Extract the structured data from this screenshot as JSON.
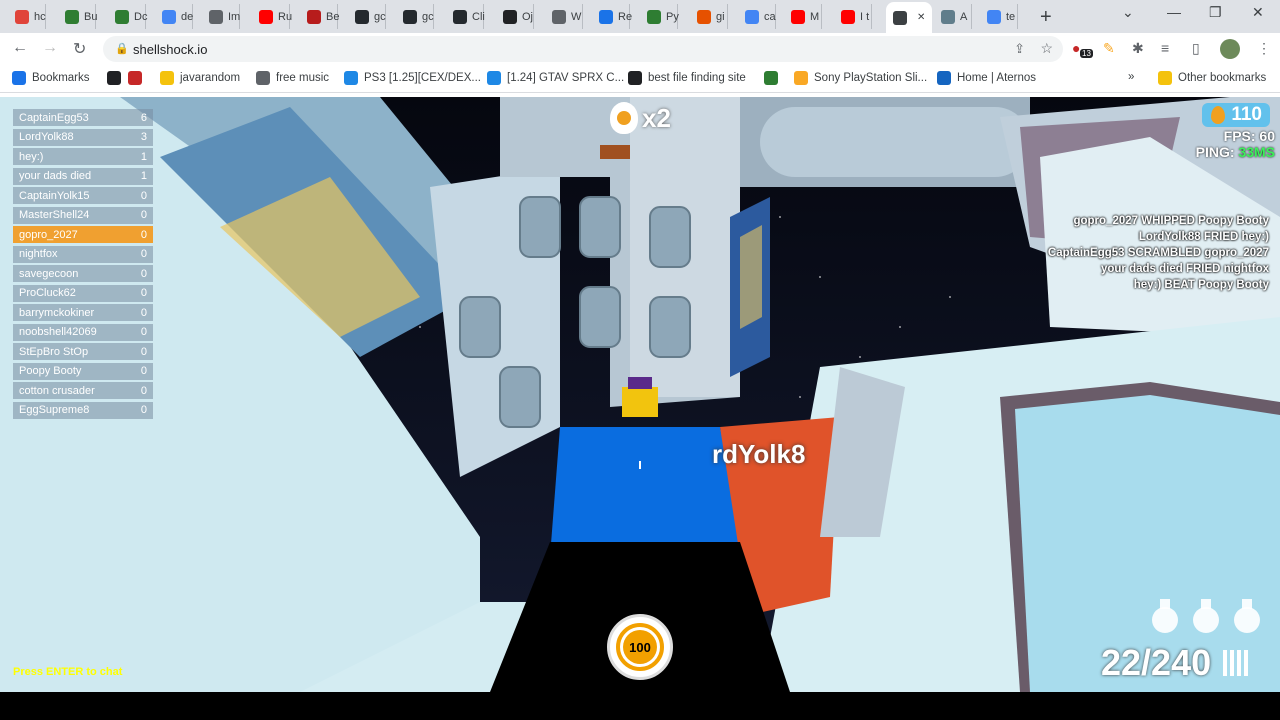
{
  "browser": {
    "tabs": [
      {
        "label": "hc",
        "color": "#e0443a"
      },
      {
        "label": "Bu",
        "color": "#2f7d32"
      },
      {
        "label": "Dc",
        "color": "#2f7d32"
      },
      {
        "label": "de",
        "color": "#4285f4"
      },
      {
        "label": "Im",
        "color": "#5f6368"
      },
      {
        "label": "Ru",
        "color": "#ff0000"
      },
      {
        "label": "Be",
        "color": "#b71c1c"
      },
      {
        "label": "gc",
        "color": "#24292e"
      },
      {
        "label": "gc",
        "color": "#24292e"
      },
      {
        "label": "Cli",
        "color": "#24292e"
      },
      {
        "label": "Oj",
        "color": "#202124"
      },
      {
        "label": "W",
        "color": "#5f6368"
      },
      {
        "label": "Re",
        "color": "#1a73e8"
      },
      {
        "label": "Py",
        "color": "#2e7d32"
      },
      {
        "label": "gi",
        "color": "#e65100"
      },
      {
        "label": "ca",
        "color": "#4285f4"
      },
      {
        "label": "M",
        "color": "#ff0000"
      },
      {
        "label": "I t",
        "color": "#ff0000"
      },
      {
        "label": "",
        "color": "#3c4043"
      },
      {
        "label": "A",
        "color": "#607d8b"
      },
      {
        "label": "te",
        "color": "#4285f4"
      }
    ],
    "new_tab": "+",
    "window_controls": {
      "dropdown": "⌄",
      "minimize": "—",
      "restore": "❐",
      "close": "✕"
    },
    "nav": {
      "back": "←",
      "forward": "→",
      "reload": "↻"
    },
    "url": "shellshock.io",
    "extension_badge": "13",
    "bookmarks": [
      {
        "label": "Bookmarks",
        "icon": "star-icon"
      },
      {
        "label": "",
        "icon": "globe-icon"
      },
      {
        "label": "",
        "icon": "heart-icon"
      },
      {
        "label": "javarandom",
        "icon": "folder-icon"
      },
      {
        "label": "free music",
        "icon": "music-icon"
      },
      {
        "label": "PS3 [1.25][CEX/DEX...",
        "icon": "c-icon"
      },
      {
        "label": "[1.24] GTAV SPRX C...",
        "icon": "c-icon"
      },
      {
        "label": "best file finding site",
        "icon": "file-icon"
      },
      {
        "label": "",
        "icon": "app-icon"
      },
      {
        "label": "Sony PlayStation Sli...",
        "icon": "bag-icon"
      },
      {
        "label": "Home | Aternos",
        "icon": "grid-icon"
      }
    ],
    "more_bookmarks": "»",
    "other_bookmarks": "Other bookmarks"
  },
  "game": {
    "scoreboard": [
      {
        "name": "CaptainEgg53",
        "score": "6",
        "me": false
      },
      {
        "name": "LordYolk88",
        "score": "3",
        "me": false
      },
      {
        "name": "hey:)",
        "score": "1",
        "me": false
      },
      {
        "name": "your dads died",
        "score": "1",
        "me": false
      },
      {
        "name": "CaptainYolk15",
        "score": "0",
        "me": false
      },
      {
        "name": "MasterShell24",
        "score": "0",
        "me": false
      },
      {
        "name": "gopro_2027",
        "score": "0",
        "me": true
      },
      {
        "name": "nightfox",
        "score": "0",
        "me": false
      },
      {
        "name": "savegecoon",
        "score": "0",
        "me": false
      },
      {
        "name": "ProCluck62",
        "score": "0",
        "me": false
      },
      {
        "name": "barrymckokiner",
        "score": "0",
        "me": false
      },
      {
        "name": "noobshell42069",
        "score": "0",
        "me": false
      },
      {
        "name": "StEpBro StOp",
        "score": "0",
        "me": false
      },
      {
        "name": "Poopy Booty",
        "score": "0",
        "me": false
      },
      {
        "name": "cotton crusader",
        "score": "0",
        "me": false
      },
      {
        "name": "EggSupreme8",
        "score": "0",
        "me": false
      }
    ],
    "killfeed": [
      "gopro_2027 WHIPPED Poopy Booty",
      "LordYolk88 FRIED hey:)",
      "CaptainEgg53 SCRAMBLED gopro_2027",
      "your dads died FRIED nightfox",
      "hey:) BEAT Poopy Booty"
    ],
    "eggs": "110",
    "fps_label": "FPS:",
    "fps": "60",
    "ping_label": "PING:",
    "ping": "33MS",
    "streak": "x2",
    "chat_hint": "Press ENTER to chat",
    "health": "100",
    "ammo": "22/240",
    "grenades": 3,
    "visible_player": "rdYolk8",
    "colors": {
      "accent": "#f0a030",
      "ping": "#3cf05a",
      "egg_box": "#62c1ec"
    }
  }
}
